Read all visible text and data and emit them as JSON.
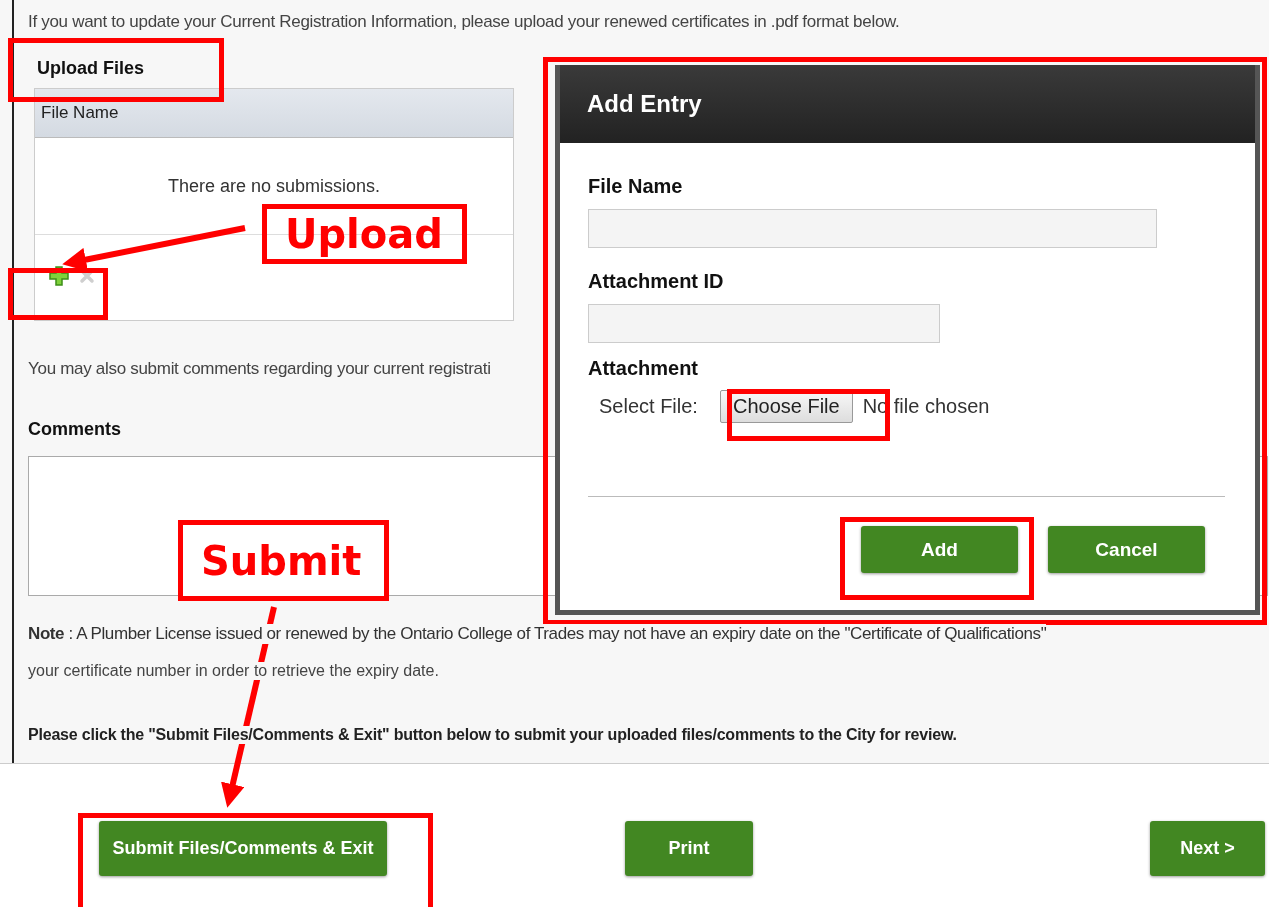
{
  "intro": "If you want to update your Current Registration Information, please upload your renewed certificates in .pdf format below.",
  "upload_section": {
    "title": "Upload Files",
    "table": {
      "columns": [
        "File Name"
      ],
      "empty_message": "There are no submissions."
    }
  },
  "comments_intro": "You may also submit comments regarding your current registrati",
  "comments": {
    "label": "Comments"
  },
  "note": {
    "text": "**Note** : A Plumber License issued or renewed by the Ontario College of Trades may not have an expiry date on the \"Certificate of Qualifications\"",
    "text_2": "your certificate number in order to retrieve the expiry date."
  },
  "instruction": "Please click the \"Submit Files/Comments & Exit\" button below to submit your uploaded files/comments to the City for review.",
  "buttons": [
    {
      "label": "Submit Files/Comments & Exit"
    },
    {
      "label": "Print"
    },
    {
      "label": "Next >"
    }
  ],
  "dialog": {
    "title": "Add Entry",
    "fields": [
      {
        "kind": "text",
        "label": "File Name"
      },
      {
        "kind": "text",
        "label": "Attachment ID"
      },
      {
        "kind": "file",
        "label": "Attachment",
        "prompt": "Select File:",
        "button": "Choose File",
        "status": "No file chosen"
      }
    ],
    "buttons": [
      "Add",
      "Cancel"
    ]
  },
  "annotations": [
    {
      "label": "Upload"
    },
    {
      "label": "Submit"
    }
  ]
}
